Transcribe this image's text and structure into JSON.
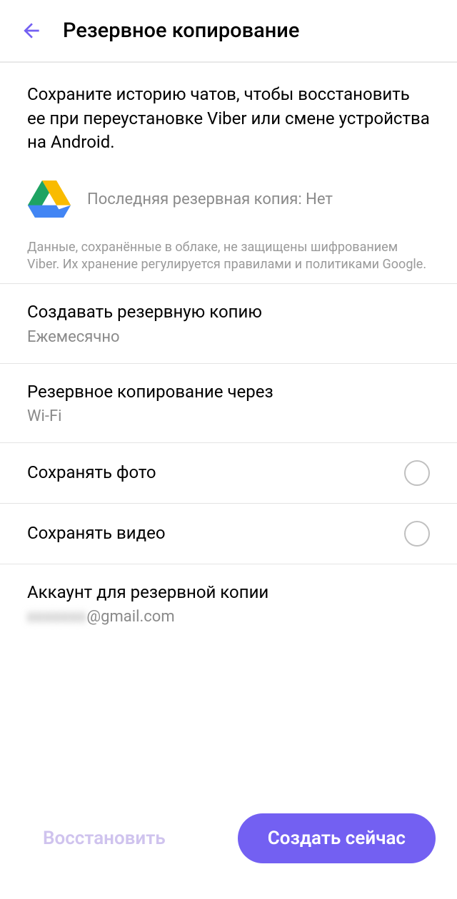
{
  "header": {
    "title": "Резервное копирование"
  },
  "intro": "Сохраните историю чатов, чтобы восстановить ее при переустановке Viber или смене устройства на Android.",
  "lastBackup": "Последняя резервная копия: Нет",
  "disclaimer": "Данные, сохранённые в облаке, не защищены шифрованием Viber. Их хранение регулируется правилами и политиками Google.",
  "rows": {
    "frequency": {
      "title": "Создавать резервную копию",
      "value": "Ежемесячно"
    },
    "over": {
      "title": "Резервное копирование через",
      "value": "Wi-Fi"
    },
    "photos": {
      "title": "Сохранять фото"
    },
    "videos": {
      "title": "Сохранять видео"
    },
    "account": {
      "title": "Аккаунт для резервной копии",
      "masked": "xxxxxxx",
      "domain": "@gmail.com"
    }
  },
  "footer": {
    "restore": "Восстановить",
    "backup": "Создать сейчас"
  }
}
